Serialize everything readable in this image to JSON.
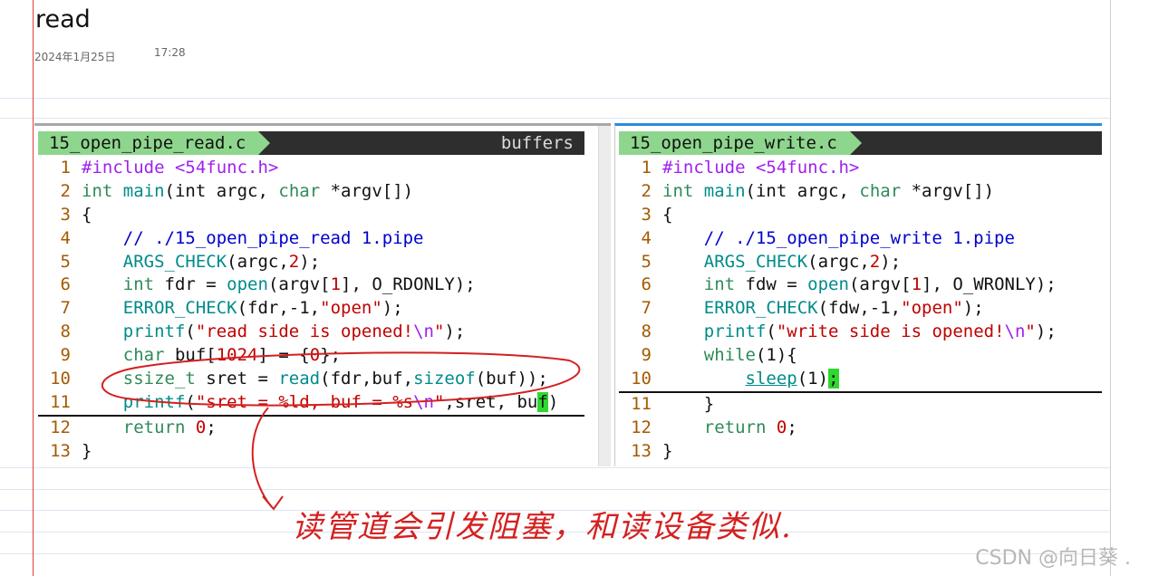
{
  "note": {
    "title": "read",
    "date": "2024年1月25日",
    "time": "17:28"
  },
  "left_pane": {
    "filename": "15_open_pipe_read.c",
    "buffers_label": "buffers",
    "lines": [
      {
        "n": "1"
      },
      {
        "n": "2"
      },
      {
        "n": "3"
      },
      {
        "n": "4"
      },
      {
        "n": "5"
      },
      {
        "n": "6"
      },
      {
        "n": "7"
      },
      {
        "n": "8"
      },
      {
        "n": "9"
      },
      {
        "n": "10"
      },
      {
        "n": "11"
      },
      {
        "n": "12"
      },
      {
        "n": "13"
      }
    ]
  },
  "right_pane": {
    "filename": "15_open_pipe_write.c",
    "lines": [
      {
        "n": "1"
      },
      {
        "n": "2"
      },
      {
        "n": "3"
      },
      {
        "n": "4"
      },
      {
        "n": "5"
      },
      {
        "n": "6"
      },
      {
        "n": "7"
      },
      {
        "n": "8"
      },
      {
        "n": "9"
      },
      {
        "n": "10"
      },
      {
        "n": "11"
      },
      {
        "n": "12"
      },
      {
        "n": "13"
      }
    ]
  },
  "code": {
    "include": "#include",
    "header": "<54func.h>",
    "int": "int",
    "main": "main",
    "char": "char",
    "argc_open": "(int argc, ",
    "argv_close": " *argv[])",
    "brace_open": "{",
    "brace_close": "}",
    "read_comment": "// ./15_open_pipe_read 1.pipe",
    "write_comment": "// ./15_open_pipe_write 1.pipe",
    "args_check": "ARGS_CHECK",
    "args_check_args_a": "(argc,",
    "two": "2",
    "close_semi": ");",
    "fdr_decl": " fdr = ",
    "fdw_decl": " fdw = ",
    "open": "open",
    "argv_open": "(argv[",
    "one": "1",
    "rdonly": "], O_RDONLY);",
    "wronly": "], O_WRONLY);",
    "error_check": "ERROR_CHECK",
    "fdr_err": "(fdr,-1,",
    "fdw_err": "(fdw,-1,",
    "open_str": "\"open\"",
    "printf": "printf",
    "paren_open": "(",
    "read_opened": "\"read side is opened!",
    "write_opened": "\"write side is opened!",
    "newline_esc": "\\n",
    "quote": "\"",
    "buf_decl": " buf[",
    "size_1024": "1024",
    "buf_init": "] = {",
    "zero": "0",
    "buf_end": "};",
    "ssize_t": "ssize_t",
    "sret_decl": " sret = ",
    "read": "read",
    "fdr_buf": "(fdr,buf,",
    "sizeof": "sizeof",
    "buf_paren": "(buf));",
    "fmt_a": "\"sret = %ld, buf = %s",
    "fmt_end": "\"",
    "sret_buf": ",sret, bu",
    "f_char": "f",
    "close_paren": ")",
    "return": "return",
    "semicolon": ";",
    "while": "while",
    "while_args": "(1){",
    "sleep": "sleep",
    "sleep_args": "(1)",
    "space": " "
  },
  "annotation_text": "读管道会引发阻塞，和读设备类似.",
  "watermark": "CSDN @向日葵 .",
  "colors": {
    "keyword": "#2e8b57",
    "preproc": "#a020f0",
    "string": "#c00000",
    "comment": "#0000cd",
    "function": "#008b8b",
    "line_number": "#a55a00",
    "statusbar_bg": "#2e2e2e",
    "filename_bg": "#8ed68e",
    "cursor": "#2ed82e",
    "annotation_ink": "#d42020"
  }
}
